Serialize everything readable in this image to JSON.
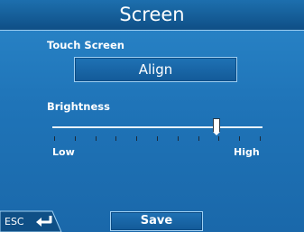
{
  "header": {
    "title": "Screen"
  },
  "touch_screen": {
    "label": "Touch Screen",
    "align_label": "Align"
  },
  "brightness": {
    "label": "Brightness",
    "low_label": "Low",
    "high_label": "High",
    "level": 0.79,
    "tick_count": 11
  },
  "footer": {
    "esc_label": "ESC",
    "save_label": "Save"
  }
}
